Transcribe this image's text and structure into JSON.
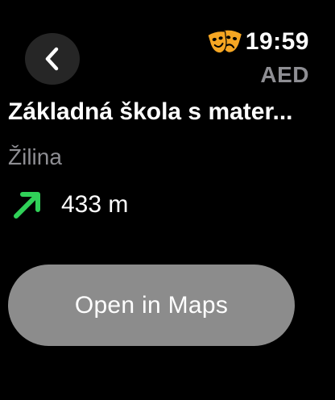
{
  "header": {
    "back_icon": "chevron-left-icon",
    "status_icon": "theater-masks-icon",
    "time": "19:59",
    "app_label": "AED"
  },
  "place": {
    "title": "Základná škola s mater...",
    "city": "Žilina"
  },
  "direction": {
    "icon": "arrow-up-right-icon",
    "distance": "433 m",
    "arrow_color": "#30d158"
  },
  "actions": {
    "open_maps_label": "Open in Maps"
  },
  "colors": {
    "background": "#000000",
    "secondary_text": "#8e8e93",
    "button_background": "#8c8c8c",
    "icon_orange": "#f5a623"
  }
}
